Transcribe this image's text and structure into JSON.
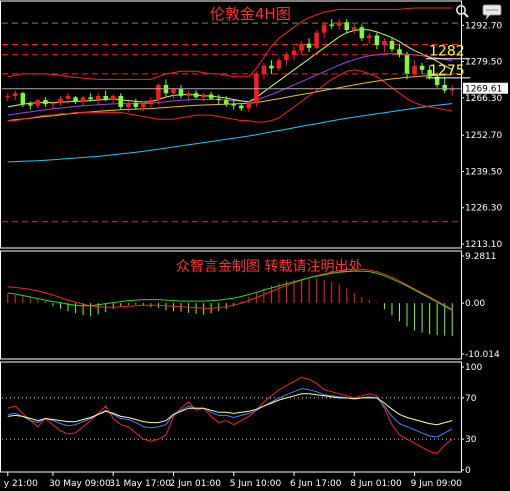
{
  "chart_data": {
    "type": "line",
    "title": "伦敦金4H图",
    "watermark": "众智言金制图  转载请注明出处",
    "colors": {
      "background": "#000000",
      "axis": "#ffffff",
      "bull": "#ff1a1a",
      "bear": "#7cff2e",
      "bollinger": "#ff2020",
      "ma_fast": "#c8ff5a",
      "ma_mid": "#a040ff",
      "ma_slow": "#f0c020",
      "ma_long": "#22c8ff",
      "level_line": "#ff2020",
      "level_text": "#ffff33",
      "macd_hist": "#ff2020",
      "macd_hist_neg": "#7cff2e",
      "macd_signal": "#ff2020",
      "macd_line": "#22dd22",
      "osc_red": "#ff2020",
      "osc_blue": "#4f7dff",
      "osc_yellow": "#ffffa0"
    },
    "price_panel": {
      "y_ticks": [
        "1292.70",
        "1279.50",
        "1266.30",
        "1252.70",
        "1239.50",
        "1226.30",
        "1213.10"
      ],
      "y_range": [
        1213.1,
        1299
      ],
      "current_price": "1269.61",
      "current_value": 1269.61,
      "levels": [
        {
          "value": 1282,
          "label": "1282"
        },
        {
          "value": 1275,
          "label": "1275"
        }
      ],
      "dashed_levels": [
        1293.5,
        1285.7,
        1221.2
      ],
      "candles": [
        [
          1266.5,
          1268,
          1265,
          1267
        ],
        [
          1267,
          1269,
          1265.5,
          1268
        ],
        [
          1268,
          1268.5,
          1263,
          1264
        ],
        [
          1264,
          1265,
          1262,
          1263.5
        ],
        [
          1263.5,
          1266,
          1262.5,
          1265.5
        ],
        [
          1265.5,
          1266.5,
          1263,
          1264
        ],
        [
          1264,
          1265,
          1262,
          1264.5
        ],
        [
          1264.5,
          1267,
          1263.5,
          1266
        ],
        [
          1266,
          1268,
          1264,
          1267
        ],
        [
          1266.5,
          1267,
          1264,
          1265
        ],
        [
          1265,
          1267,
          1263.5,
          1266.5
        ],
        [
          1266.5,
          1268,
          1265,
          1265.8
        ],
        [
          1265.8,
          1268,
          1264,
          1267
        ],
        [
          1267,
          1269,
          1265,
          1265.5
        ],
        [
          1265.5,
          1267.5,
          1264,
          1267
        ],
        [
          1267,
          1268,
          1262,
          1263
        ],
        [
          1263,
          1265,
          1261,
          1264.5
        ],
        [
          1264.5,
          1266,
          1262,
          1263
        ],
        [
          1263,
          1265,
          1261.5,
          1264
        ],
        [
          1264,
          1266.5,
          1263,
          1265.5
        ],
        [
          1265.5,
          1271.5,
          1264,
          1271
        ],
        [
          1271,
          1273,
          1267,
          1268
        ],
        [
          1268,
          1270,
          1266,
          1269.5
        ],
        [
          1269.5,
          1271,
          1266,
          1267
        ],
        [
          1267,
          1269,
          1265,
          1268
        ],
        [
          1268,
          1269,
          1266,
          1266.5
        ],
        [
          1266.5,
          1268,
          1265,
          1267.5
        ],
        [
          1267.5,
          1268.5,
          1265.5,
          1266
        ],
        [
          1266,
          1267.5,
          1264,
          1265.5
        ],
        [
          1265.5,
          1267,
          1263,
          1264
        ],
        [
          1264,
          1265.5,
          1262,
          1263.5
        ],
        [
          1263.5,
          1264,
          1261.5,
          1262.5
        ],
        [
          1262.5,
          1265,
          1261,
          1264.5
        ],
        [
          1264.5,
          1276,
          1263,
          1275
        ],
        [
          1275,
          1279,
          1273,
          1278
        ],
        [
          1278,
          1280,
          1275,
          1277
        ],
        [
          1277,
          1281,
          1276,
          1280
        ],
        [
          1280,
          1283,
          1278,
          1282
        ],
        [
          1282,
          1285,
          1280,
          1283.5
        ],
        [
          1283.5,
          1287,
          1282,
          1286
        ],
        [
          1286,
          1288,
          1283,
          1284.5
        ],
        [
          1284.5,
          1291,
          1284,
          1290
        ],
        [
          1290,
          1294,
          1288,
          1293
        ],
        [
          1293,
          1295,
          1291.5,
          1292.5
        ],
        [
          1292.5,
          1295,
          1291,
          1293.8
        ],
        [
          1293.8,
          1295,
          1290,
          1291
        ],
        [
          1291,
          1293.5,
          1289.5,
          1292
        ],
        [
          1292,
          1293,
          1287,
          1288
        ],
        [
          1288,
          1290,
          1286,
          1289
        ],
        [
          1289,
          1290,
          1284,
          1285.5
        ],
        [
          1285.5,
          1288,
          1283,
          1287
        ],
        [
          1287,
          1288,
          1283,
          1284
        ],
        [
          1284,
          1286,
          1281,
          1282
        ],
        [
          1282,
          1283,
          1273,
          1275
        ],
        [
          1275,
          1280,
          1274,
          1278
        ],
        [
          1278,
          1279,
          1275,
          1276.5
        ],
        [
          1276.5,
          1278,
          1273,
          1274
        ],
        [
          1274,
          1275.5,
          1270,
          1271
        ],
        [
          1271,
          1274,
          1268,
          1269
        ],
        [
          1269,
          1271,
          1267,
          1269.61
        ]
      ],
      "bb_upper": [
        1274,
        1274.5,
        1275,
        1275,
        1275,
        1275,
        1274.8,
        1274.5,
        1274,
        1273.8,
        1273.5,
        1273.2,
        1273,
        1273,
        1273,
        1273,
        1273,
        1273,
        1273,
        1273,
        1274,
        1275,
        1275.5,
        1276,
        1276,
        1276,
        1275.5,
        1275,
        1275,
        1274.5,
        1274,
        1274,
        1274,
        1277,
        1281,
        1285,
        1288,
        1290,
        1292,
        1294,
        1295.5,
        1296.5,
        1297.5,
        1298,
        1298.5,
        1298.5,
        1298.5,
        1298.5,
        1298.5,
        1298.5,
        1298.5,
        1298.5,
        1298.5,
        1298.8,
        1299,
        1299,
        1299,
        1299,
        1299,
        1299
      ],
      "bb_lower": [
        1258,
        1258,
        1258.5,
        1259,
        1259.5,
        1260,
        1260,
        1260.5,
        1260.5,
        1261,
        1261,
        1261,
        1261,
        1261,
        1261,
        1261,
        1260.5,
        1260,
        1259.5,
        1259,
        1258.5,
        1258.5,
        1258.5,
        1259,
        1259.5,
        1260,
        1260,
        1260,
        1259.5,
        1259,
        1258.5,
        1258,
        1258,
        1257.5,
        1257.5,
        1258,
        1259,
        1261,
        1263,
        1265,
        1267,
        1269,
        1271,
        1273,
        1274.5,
        1276,
        1276.5,
        1276,
        1275,
        1274,
        1272,
        1270,
        1268,
        1266,
        1264.5,
        1263.5,
        1263,
        1262.5,
        1262,
        1261.5
      ],
      "ma_fast": [
        1263,
        1263.5,
        1264,
        1264.3,
        1264.5,
        1264.6,
        1264.6,
        1264.7,
        1264.9,
        1265,
        1265.1,
        1265.3,
        1265.5,
        1265.7,
        1265.9,
        1265.6,
        1265.3,
        1265,
        1264.8,
        1264.9,
        1265.7,
        1266.6,
        1267.2,
        1267.4,
        1267.5,
        1267.3,
        1267.1,
        1266.9,
        1266.6,
        1266.2,
        1265.7,
        1265.2,
        1264.8,
        1266.5,
        1268.5,
        1270.5,
        1272.5,
        1274.5,
        1276.5,
        1278.5,
        1280.5,
        1282.5,
        1284.5,
        1286.5,
        1288.5,
        1290,
        1290.8,
        1291.2,
        1291,
        1290.3,
        1289.3,
        1288.2,
        1286.8,
        1285,
        1283.5,
        1282.3,
        1281,
        1279.6,
        1278,
        1276.6
      ],
      "ma_mid": [
        1260,
        1260.4,
        1260.8,
        1261.2,
        1261.6,
        1262,
        1262.3,
        1262.6,
        1262.9,
        1263.2,
        1263.4,
        1263.6,
        1263.8,
        1264,
        1264.1,
        1264.2,
        1264.2,
        1264.2,
        1264.2,
        1264.3,
        1264.6,
        1264.9,
        1265.2,
        1265.4,
        1265.6,
        1265.7,
        1265.7,
        1265.7,
        1265.6,
        1265.5,
        1265.3,
        1265.1,
        1265,
        1265.6,
        1266.5,
        1267.5,
        1268.6,
        1269.8,
        1271,
        1272.2,
        1273.4,
        1274.6,
        1275.8,
        1277,
        1278.2,
        1279.3,
        1280.2,
        1281,
        1281.6,
        1282,
        1282.3,
        1282.4,
        1282.4,
        1282.2,
        1281.9,
        1281.6,
        1281.2,
        1280.8,
        1280.3,
        1279.8
      ],
      "ma_slow": [
        1258,
        1258.3,
        1258.6,
        1258.9,
        1259.2,
        1259.5,
        1259.8,
        1260.1,
        1260.4,
        1260.7,
        1261,
        1261.2,
        1261.4,
        1261.6,
        1261.8,
        1262,
        1262.1,
        1262.2,
        1262.3,
        1262.4,
        1262.6,
        1262.8,
        1263,
        1263.2,
        1263.4,
        1263.6,
        1263.7,
        1263.8,
        1263.9,
        1264,
        1264.1,
        1264.2,
        1264.3,
        1264.6,
        1265,
        1265.5,
        1266,
        1266.5,
        1267,
        1267.5,
        1268,
        1268.5,
        1269,
        1269.5,
        1270,
        1270.5,
        1271,
        1271.5,
        1272,
        1272.4,
        1272.8,
        1273.2,
        1273.5,
        1273.8,
        1274,
        1274.2,
        1274.4,
        1274.5,
        1274.6,
        1274.7
      ],
      "ma_long": [
        1243,
        1243.1,
        1243.2,
        1243.3,
        1243.4,
        1243.6,
        1243.8,
        1244,
        1244.2,
        1244.4,
        1244.6,
        1244.8,
        1245,
        1245.3,
        1245.6,
        1245.9,
        1246.2,
        1246.5,
        1246.8,
        1247.2,
        1247.6,
        1248,
        1248.4,
        1248.8,
        1249.2,
        1249.6,
        1250,
        1250.4,
        1250.8,
        1251.2,
        1251.6,
        1252,
        1252.4,
        1252.9,
        1253.4,
        1253.9,
        1254.4,
        1254.9,
        1255.4,
        1255.9,
        1256.4,
        1256.9,
        1257.4,
        1257.9,
        1258.4,
        1258.9,
        1259.3,
        1259.7,
        1260.1,
        1260.5,
        1260.9,
        1261.3,
        1261.7,
        1262.1,
        1262.5,
        1262.9,
        1263.3,
        1263.6,
        1263.9,
        1264.2
      ]
    },
    "macd_panel": {
      "y_ticks": [
        "9.2811",
        "0.00",
        "-10.014"
      ],
      "y_range": [
        -10.014,
        9.2811
      ],
      "histogram": [
        1.8,
        1.6,
        1.4,
        1.2,
        0.8,
        0.4,
        -0.6,
        -1.1,
        -1.6,
        -2,
        -2.4,
        -2.6,
        -2.2,
        -1.8,
        -1.2,
        -0.8,
        -0.4,
        -0.3,
        -0.5,
        -0.8,
        -1,
        -1.4,
        -1.6,
        -1.7,
        -1.9,
        -2.1,
        -2.3,
        -2,
        -1.6,
        -1.2,
        -0.6,
        0.4,
        1.2,
        2,
        2.8,
        3.4,
        3.9,
        4.3,
        4.6,
        4.8,
        4.9,
        4.8,
        4.6,
        4.2,
        3.7,
        2.9,
        2,
        1.2,
        0.6,
        0.2,
        -1.2,
        -2.4,
        -3.6,
        -4.6,
        -5.4,
        -5.8,
        -6.1,
        -6.3,
        -6.4,
        -6.5
      ],
      "signal": [
        3.2,
        3.1,
        2.9,
        2.7,
        2.4,
        2,
        1.6,
        1.1,
        0.6,
        0.2,
        -0.2,
        -0.5,
        -0.7,
        -0.8,
        -0.8,
        -0.7,
        -0.6,
        -0.5,
        -0.4,
        -0.4,
        -0.4,
        -0.5,
        -0.6,
        -0.7,
        -0.8,
        -0.9,
        -1,
        -1,
        -0.9,
        -0.7,
        -0.4,
        0,
        0.5,
        1.1,
        1.7,
        2.3,
        2.9,
        3.5,
        4,
        4.5,
        5,
        5.4,
        5.8,
        6.1,
        6.4,
        6.6,
        6.7,
        6.7,
        6.5,
        6.2,
        5.7,
        5.1,
        4.4,
        3.6,
        2.8,
        2,
        1.2,
        0.4,
        -0.4,
        -1.2
      ],
      "macd": [
        2,
        1.8,
        1.5,
        1.2,
        0.9,
        0.6,
        0.3,
        0.1,
        -0.2,
        -0.4,
        -0.5,
        -0.5,
        -0.3,
        -0.1,
        0.1,
        0.3,
        0.5,
        0.6,
        0.7,
        0.7,
        0.7,
        0.6,
        0.5,
        0.4,
        0.4,
        0.4,
        0.4,
        0.5,
        0.6,
        0.8,
        1,
        1.3,
        1.7,
        2.1,
        2.6,
        3,
        3.4,
        3.8,
        4.2,
        4.6,
        5,
        5.3,
        5.6,
        5.9,
        6.1,
        6.2,
        6.3,
        6.3,
        6.2,
        5.9,
        5.4,
        4.8,
        4.1,
        3.4,
        2.6,
        1.8,
        1,
        0.2,
        -0.6,
        -1.4
      ]
    },
    "osc_panel": {
      "y_ticks": [
        "100",
        "70",
        "30",
        "0"
      ],
      "y_range": [
        0,
        100
      ],
      "dotted_levels": [
        70,
        30
      ],
      "red": [
        60,
        62,
        55,
        48,
        42,
        50,
        44,
        38,
        35,
        36,
        42,
        48,
        55,
        62,
        50,
        44,
        42,
        36,
        30,
        28,
        30,
        34,
        52,
        60,
        66,
        58,
        60,
        52,
        46,
        48,
        44,
        48,
        52,
        58,
        66,
        72,
        78,
        82,
        86,
        90,
        88,
        84,
        78,
        76,
        74,
        72,
        70,
        72,
        74,
        72,
        60,
        44,
        34,
        30,
        26,
        22,
        18,
        16,
        24,
        30
      ],
      "blue": [
        54,
        55,
        52,
        48,
        46,
        50,
        48,
        45,
        43,
        44,
        47,
        50,
        54,
        58,
        54,
        50,
        49,
        46,
        42,
        41,
        42,
        44,
        54,
        58,
        62,
        60,
        60,
        56,
        53,
        53,
        51,
        53,
        55,
        58,
        62,
        66,
        70,
        73,
        76,
        79,
        78,
        76,
        73,
        72,
        71,
        70,
        69,
        70,
        71,
        70,
        62,
        52,
        45,
        42,
        39,
        36,
        33,
        32,
        36,
        40
      ],
      "yellow": [
        52,
        53,
        52,
        50,
        48,
        50,
        49,
        48,
        47,
        47,
        49,
        51,
        54,
        57,
        55,
        52,
        51,
        49,
        47,
        46,
        46,
        48,
        54,
        57,
        60,
        60,
        60,
        58,
        56,
        56,
        55,
        56,
        57,
        59,
        62,
        65,
        68,
        70,
        72,
        74,
        74,
        73,
        72,
        71,
        70,
        70,
        69,
        70,
        70,
        70,
        65,
        59,
        54,
        51,
        49,
        47,
        45,
        44,
        46,
        48
      ]
    },
    "x_labels": [
      {
        "i": 0,
        "label": "y 21:00"
      },
      {
        "i": 6,
        "label": "30 May 09:00"
      },
      {
        "i": 14,
        "label": "31 May 17:00"
      },
      {
        "i": 22,
        "label": "2 Jun 01:00"
      },
      {
        "i": 30,
        "label": "5 Jun 10:00"
      },
      {
        "i": 38,
        "label": "6 Jun 17:00"
      },
      {
        "i": 46,
        "label": "8 Jun 01:00"
      },
      {
        "i": 54,
        "label": "9 Jun 09:00"
      }
    ],
    "icons": [
      "search-icon",
      "chat-icon"
    ]
  }
}
